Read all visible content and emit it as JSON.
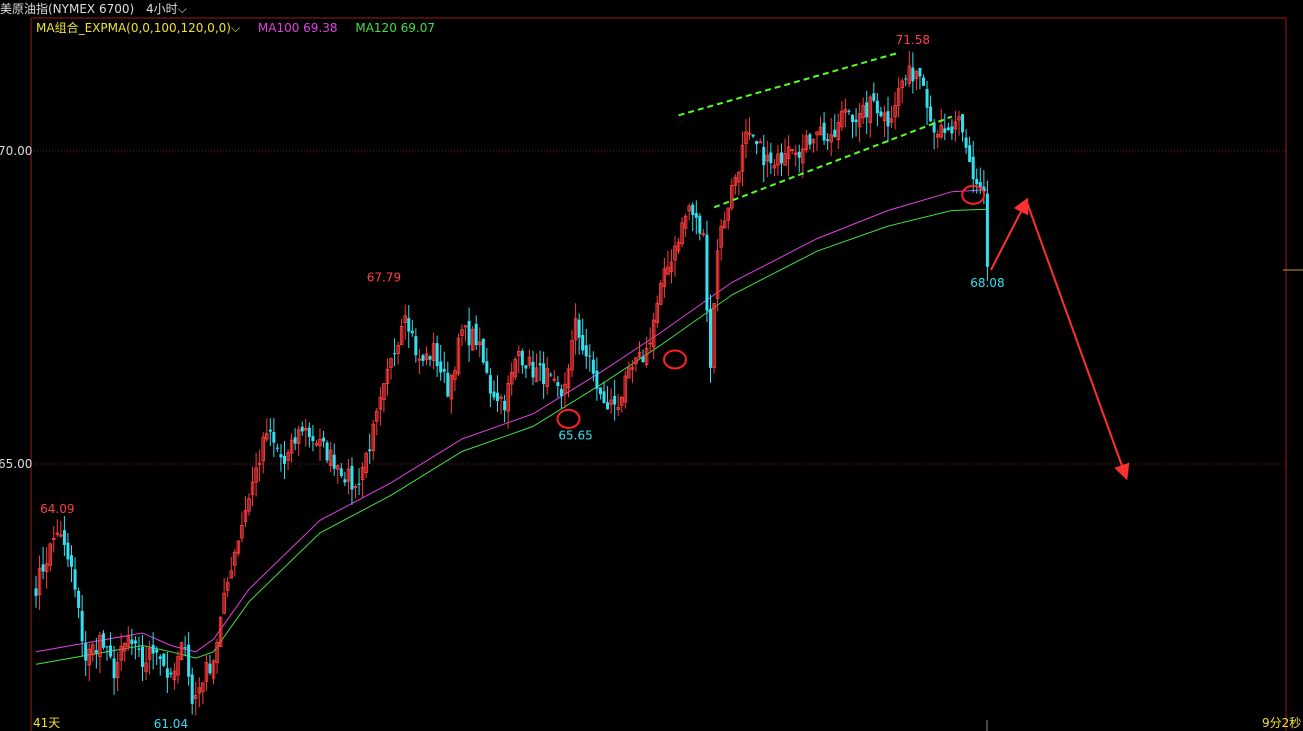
{
  "header": {
    "instrument": "美原油指(NYMEX 6700)",
    "period": "4小时"
  },
  "legend": {
    "combo": "MA组合_EXPMA(0,0,100,120,0,0)",
    "ma100": "MA100 69.38",
    "ma120": "MA120 69.07"
  },
  "footer": {
    "left": "41天",
    "right": "9分2秒"
  },
  "colors": {
    "up": "#ff3b3b",
    "down": "#33e0f0",
    "ma100": "#e040e0",
    "ma120": "#40e040",
    "grid": "#8b1a1a",
    "channel": "#55ff22",
    "arrow": "#ff3030",
    "marker": "#ff2020"
  },
  "chart_data": {
    "type": "candlestick",
    "y_axis": {
      "ticks": [
        65,
        70
      ],
      "tick_labels": [
        "65.00",
        "70.00"
      ],
      "ylim": [
        60.7,
        72.3
      ]
    },
    "annotations": [
      {
        "text": "64.09",
        "value": 64.09,
        "kind": "high"
      },
      {
        "text": "61.04",
        "value": 61.04,
        "kind": "low"
      },
      {
        "text": "67.79",
        "value": 67.79,
        "kind": "high"
      },
      {
        "text": "65.65",
        "value": 65.65,
        "kind": "low"
      },
      {
        "text": "71.58",
        "value": 71.58,
        "kind": "high"
      },
      {
        "text": "68.08",
        "value": 68.08,
        "kind": "last"
      }
    ],
    "anchors": [
      [
        0,
        63.05
      ],
      [
        6,
        63.95
      ],
      [
        10,
        63.3
      ],
      [
        14,
        61.9
      ],
      [
        18,
        62.2
      ],
      [
        22,
        61.7
      ],
      [
        26,
        62.2
      ],
      [
        30,
        61.8
      ],
      [
        34,
        62.1
      ],
      [
        38,
        61.5
      ],
      [
        42,
        62.2
      ],
      [
        44,
        61.15
      ],
      [
        47,
        61.6
      ],
      [
        50,
        61.9
      ],
      [
        55,
        63.4
      ],
      [
        60,
        64.5
      ],
      [
        65,
        65.5
      ],
      [
        70,
        65.0
      ],
      [
        75,
        65.6
      ],
      [
        80,
        65.3
      ],
      [
        85,
        65.0
      ],
      [
        90,
        64.6
      ],
      [
        95,
        65.5
      ],
      [
        100,
        66.6
      ],
      [
        104,
        67.5
      ],
      [
        108,
        66.6
      ],
      [
        112,
        66.8
      ],
      [
        116,
        66.2
      ],
      [
        120,
        67.1
      ],
      [
        124,
        67.0
      ],
      [
        128,
        66.2
      ],
      [
        132,
        66.0
      ],
      [
        136,
        66.8
      ],
      [
        140,
        66.5
      ],
      [
        144,
        66.4
      ],
      [
        148,
        66.0
      ],
      [
        152,
        67.2
      ],
      [
        156,
        66.6
      ],
      [
        160,
        65.9
      ],
      [
        164,
        66.0
      ],
      [
        168,
        66.5
      ],
      [
        172,
        66.8
      ],
      [
        176,
        67.8
      ],
      [
        180,
        68.5
      ],
      [
        184,
        69.1
      ],
      [
        188,
        68.6
      ],
      [
        190,
        66.6
      ],
      [
        192,
        68.5
      ],
      [
        196,
        69.4
      ],
      [
        200,
        70.2
      ],
      [
        204,
        70.0
      ],
      [
        208,
        69.7
      ],
      [
        212,
        70.2
      ],
      [
        216,
        70.0
      ],
      [
        220,
        70.4
      ],
      [
        224,
        70.1
      ],
      [
        228,
        70.7
      ],
      [
        232,
        70.5
      ],
      [
        236,
        70.8
      ],
      [
        240,
        70.5
      ],
      [
        244,
        71.1
      ],
      [
        248,
        71.3
      ],
      [
        250,
        71.2
      ],
      [
        252,
        70.5
      ],
      [
        256,
        70.2
      ],
      [
        260,
        70.4
      ],
      [
        264,
        69.6
      ],
      [
        266,
        69.4
      ],
      [
        268,
        68.15
      ]
    ],
    "channel": {
      "upper": [
        [
          181,
          70.57
        ],
        [
          243,
          71.57
        ]
      ],
      "lower": [
        [
          191,
          69.1
        ],
        [
          258,
          70.55
        ]
      ]
    },
    "forecast_arrow": [
      [
        269,
        68.1
      ],
      [
        279,
        69.2
      ],
      [
        307,
        64.8
      ]
    ],
    "ma100": [
      [
        0,
        62.0
      ],
      [
        30,
        62.3
      ],
      [
        38,
        62.1
      ],
      [
        45,
        62.0
      ],
      [
        50,
        62.2
      ],
      [
        60,
        63.0
      ],
      [
        80,
        64.1
      ],
      [
        100,
        64.7
      ],
      [
        120,
        65.4
      ],
      [
        140,
        65.8
      ],
      [
        160,
        66.5
      ],
      [
        176,
        67.1
      ],
      [
        196,
        67.9
      ],
      [
        220,
        68.6
      ],
      [
        240,
        69.05
      ],
      [
        258,
        69.35
      ],
      [
        268,
        69.38
      ]
    ],
    "ma120": [
      [
        0,
        61.8
      ],
      [
        30,
        62.1
      ],
      [
        38,
        62.0
      ],
      [
        45,
        61.9
      ],
      [
        50,
        62.0
      ],
      [
        60,
        62.8
      ],
      [
        80,
        63.9
      ],
      [
        100,
        64.5
      ],
      [
        120,
        65.2
      ],
      [
        140,
        65.6
      ],
      [
        160,
        66.3
      ],
      [
        176,
        66.9
      ],
      [
        196,
        67.7
      ],
      [
        220,
        68.4
      ],
      [
        240,
        68.8
      ],
      [
        258,
        69.05
      ],
      [
        268,
        69.07
      ]
    ],
    "markers": [
      [
        150,
        65.72
      ],
      [
        180,
        66.67
      ],
      [
        264,
        69.3
      ]
    ]
  }
}
